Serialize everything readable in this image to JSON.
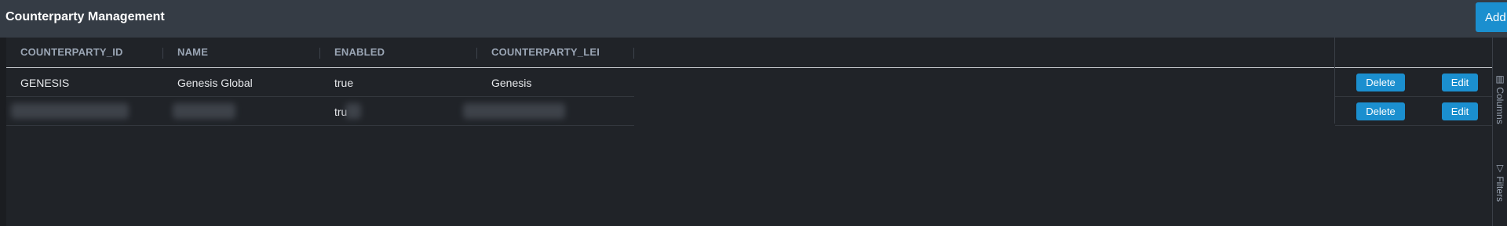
{
  "header": {
    "title": "Counterparty Management",
    "add_label": "Add"
  },
  "grid": {
    "columns": [
      "COUNTERPARTY_ID",
      "NAME",
      "ENABLED",
      "COUNTERPARTY_LEI"
    ],
    "rows": [
      {
        "counterparty_id": "GENESIS",
        "name": "Genesis Global",
        "enabled": "true",
        "lei": "Genesis",
        "redacted": false
      },
      {
        "counterparty_id": "",
        "name": "",
        "enabled": "tru",
        "lei": "",
        "redacted": true
      }
    ],
    "actions": {
      "delete_label": "Delete",
      "edit_label": "Edit"
    }
  },
  "side_panel": {
    "columns_label": "Columns",
    "filters_label": "Filters",
    "columns_icon": "columns-icon",
    "filters_icon": "filter-icon"
  },
  "colors": {
    "header_bg": "#353c45",
    "panel_bg": "#202328",
    "accent": "#1b8fcf",
    "header_text": "#9aa5b4"
  }
}
